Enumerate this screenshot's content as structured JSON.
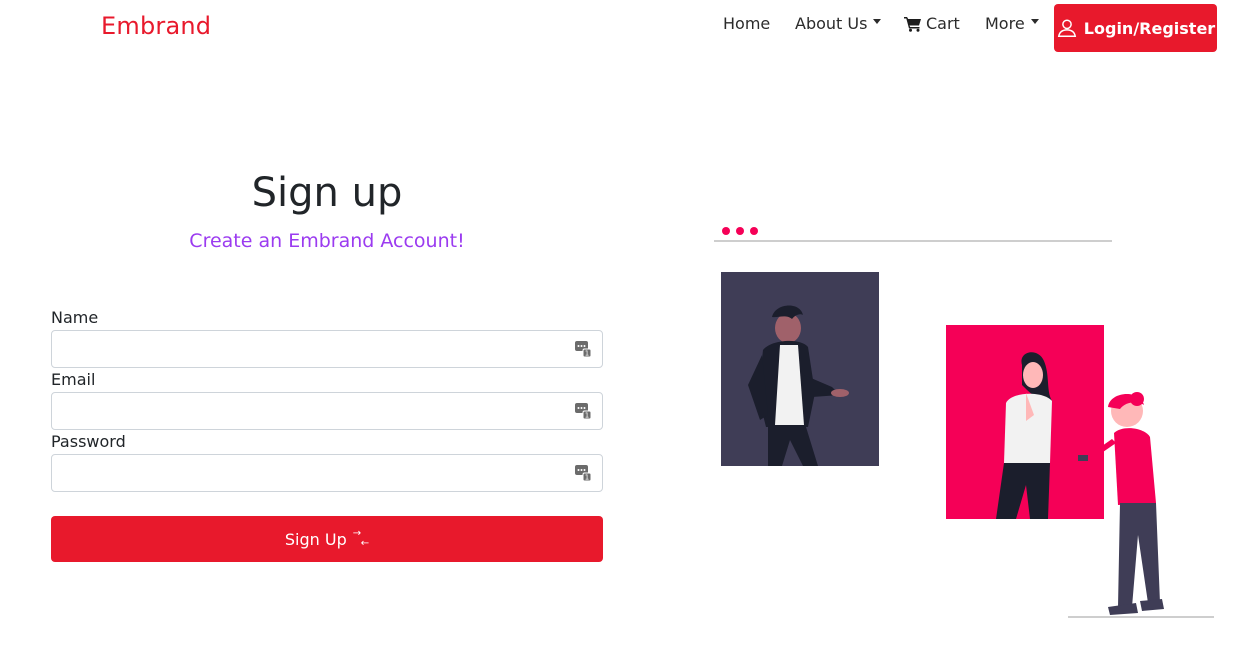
{
  "navbar": {
    "brand": "Embrand",
    "links": [
      {
        "label": "Home"
      },
      {
        "label": "About Us"
      },
      {
        "label": "Cart"
      },
      {
        "label": "More"
      }
    ],
    "login_label": "Login/Register"
  },
  "form": {
    "title": "Sign up",
    "subtitle": "Create an Embrand Account!",
    "fields": [
      {
        "label": "Name",
        "value": "",
        "icon": "autofill-icon"
      },
      {
        "label": "Email",
        "value": "",
        "icon": "autofill-icon"
      },
      {
        "label": "Password",
        "value": "",
        "icon": "autofill-icon"
      }
    ],
    "submit_label": "Sign Up"
  },
  "colors": {
    "brand": "#e8192c",
    "subtitle": "#9b3bf0",
    "illustration_dark": "#3f3d56",
    "illustration_pink": "#f50057"
  }
}
